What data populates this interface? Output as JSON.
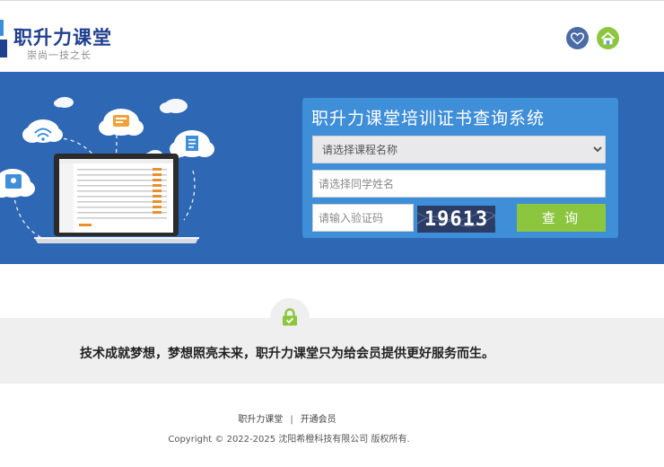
{
  "header": {
    "logo_title": "职升力课堂",
    "logo_slogan": "崇尚一技之长",
    "favorite_icon": "heart-icon",
    "home_icon": "home-icon",
    "colors": {
      "brand": "#1f3f8f",
      "favorite": "#4b6ba5",
      "home": "#8cc63f"
    }
  },
  "banner": {
    "background": "#2e67b3",
    "panel_title": "职升力课堂培训证书查询系统",
    "course_select": {
      "placeholder": "请选择课程名称"
    },
    "name_input": {
      "placeholder": "请选择同学姓名"
    },
    "code_input": {
      "placeholder": "请输入验证码"
    },
    "captcha_text": "19613",
    "query_label": "查 询"
  },
  "band": {
    "lock_icon": "lock-icon",
    "text": "技术成就梦想，梦想照亮未来，职升力课堂只为给会员提供更好服务而生。"
  },
  "footer": {
    "links": [
      "职升力课堂",
      "开通会员"
    ],
    "separator": "|",
    "copyright": "Copyright © 2022-2025 沈阳希橙科技有限公司 版权所有."
  }
}
